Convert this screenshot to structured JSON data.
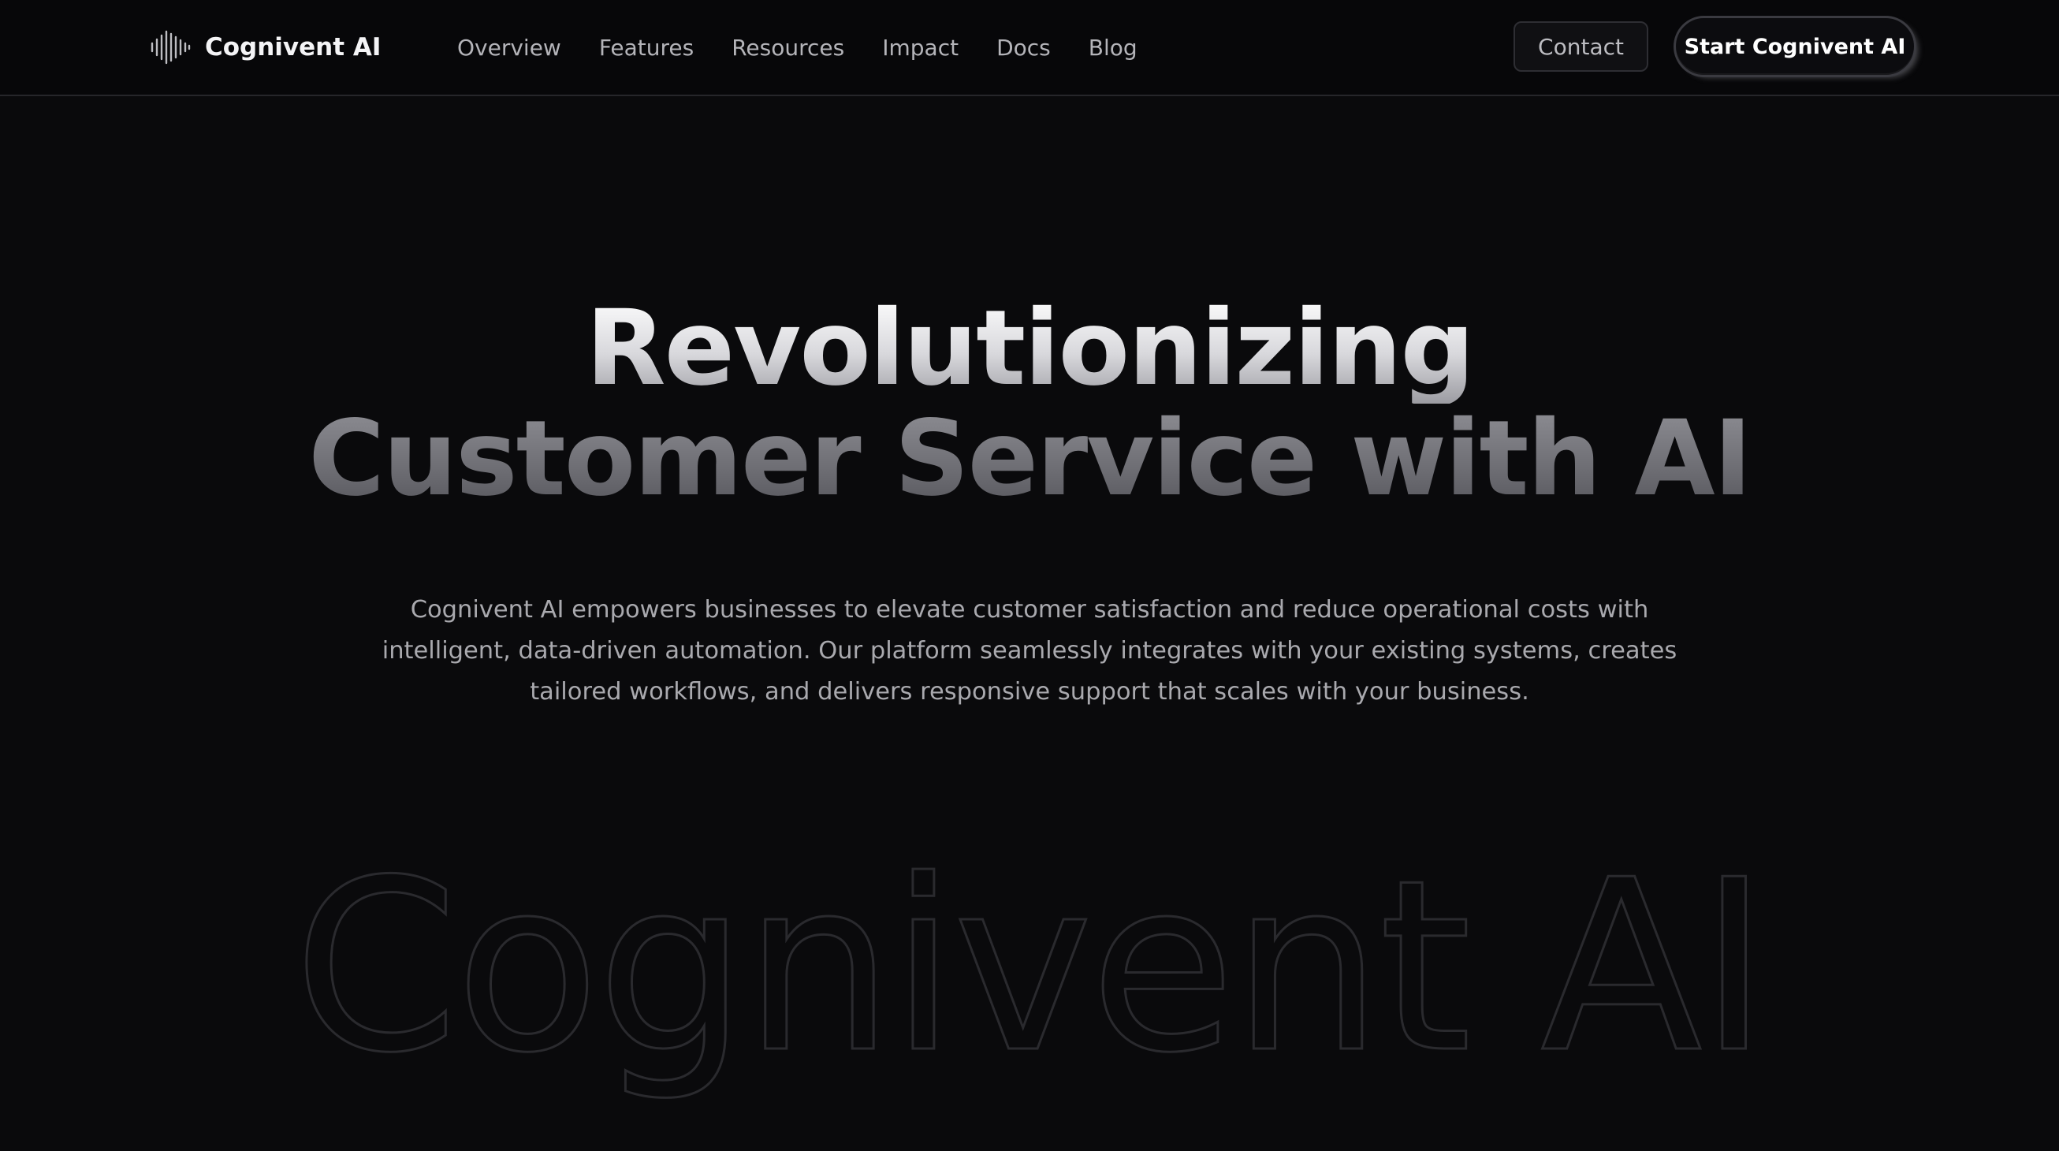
{
  "header": {
    "brand": {
      "name": "Cognivent AI",
      "logo_icon": "soundwave-icon"
    },
    "nav": [
      {
        "label": "Overview"
      },
      {
        "label": "Features"
      },
      {
        "label": "Resources"
      },
      {
        "label": "Impact"
      },
      {
        "label": "Docs"
      },
      {
        "label": "Blog"
      }
    ],
    "contact_label": "Contact",
    "cta_label": "Start Cognivent AI"
  },
  "hero": {
    "title_line_1": "Revolutionizing",
    "title_line_2": "Customer Service with AI",
    "description_lines": [
      "Cognivent AI empowers businesses to elevate customer satisfaction and reduce operational costs with",
      "intelligent, data-driven automation. Our platform seamlessly integrates with your existing systems, creates",
      "tailored workflows, and delivers responsive support that scales with your business."
    ]
  },
  "watermark": {
    "text": "Cognivent AI"
  },
  "colors": {
    "background": "#0a0a0c",
    "header_background": "#070709",
    "nav_text": "#b4b4b9",
    "body_text": "#a9a9ae",
    "outline_stroke": "#2a2a2e"
  }
}
